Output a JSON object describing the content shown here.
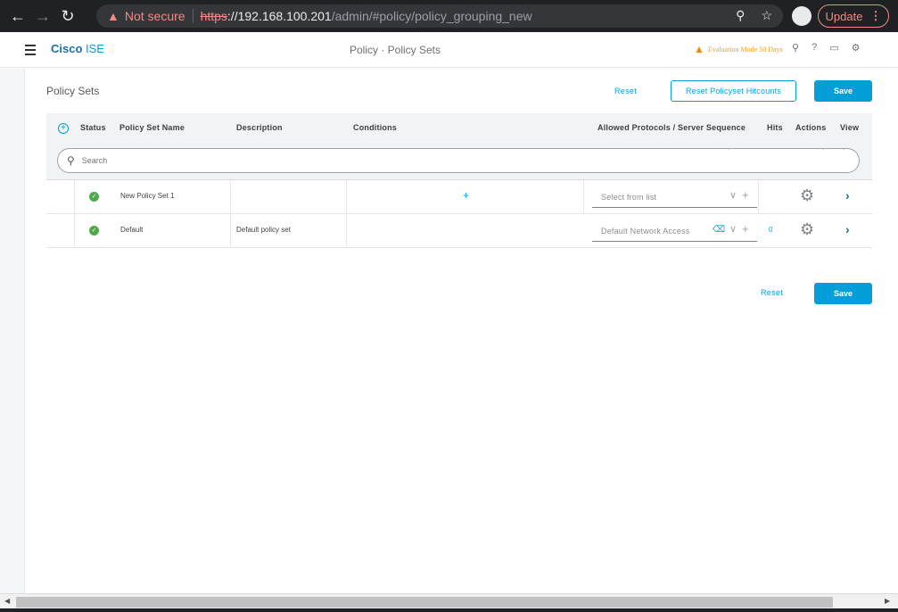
{
  "browser": {
    "not_secure": "Not secure",
    "url_scheme": "https",
    "url_host": "://192.168.100.201",
    "url_path": "/admin/#policy/policy_grouping_new",
    "update_label": "Update"
  },
  "header": {
    "brand_bold": "Cisco",
    "brand_rest": " ISE",
    "title": "Policy · Policy Sets",
    "evaluation": "Evaluation Mode 50 Days"
  },
  "page": {
    "section_title": "Policy Sets",
    "reset_label": "Reset",
    "reset_hitcounts_label": "Reset Policyset Hitcounts",
    "save_label": "Save"
  },
  "table": {
    "columns": {
      "status": "Status",
      "name": "Policy Set Name",
      "description": "Description",
      "conditions": "Conditions",
      "protocols": "Allowed Protocols / Server Sequence",
      "hits": "Hits",
      "actions": "Actions",
      "view": "View"
    },
    "search_placeholder": "Search",
    "rows": [
      {
        "name": "New Policy Set 1",
        "description": "",
        "protocol": "Select from list",
        "hits": ""
      },
      {
        "name": "Default",
        "description": "Default policy set",
        "protocol": "Default Network Access",
        "hits": "0"
      }
    ]
  },
  "footer": {
    "reset_label": "Reset",
    "save_label": "Save"
  },
  "colors": {
    "accent": "#049fd9",
    "status_ok": "#4fa84c",
    "warning": "#f29d20"
  }
}
